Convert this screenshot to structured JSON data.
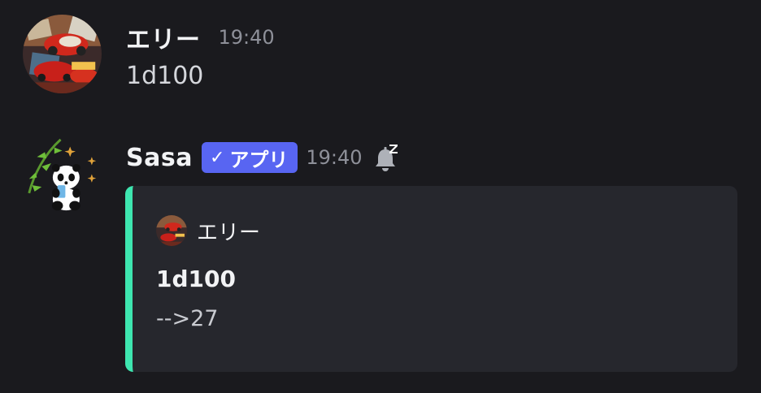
{
  "messages": [
    {
      "author": "エリー",
      "time": "19:40",
      "content": "1d100",
      "avatar_icon": "car-avatar-icon"
    },
    {
      "author": "Sasa",
      "badge": "アプリ",
      "badge_check": "✓",
      "time": "19:40",
      "status_icon": "snooze-bell-icon",
      "avatar_icon": "panda-bamboo-avatar-icon",
      "embed": {
        "accent_color": "#3ee6b0",
        "author": "エリー",
        "title": "1d100",
        "description": "-->27"
      }
    }
  ],
  "colors": {
    "background": "#1a1a1e",
    "embed_background": "#26272d",
    "app_badge": "#5865f2",
    "username": "#f2f3f5",
    "timestamp": "#8e9099"
  }
}
